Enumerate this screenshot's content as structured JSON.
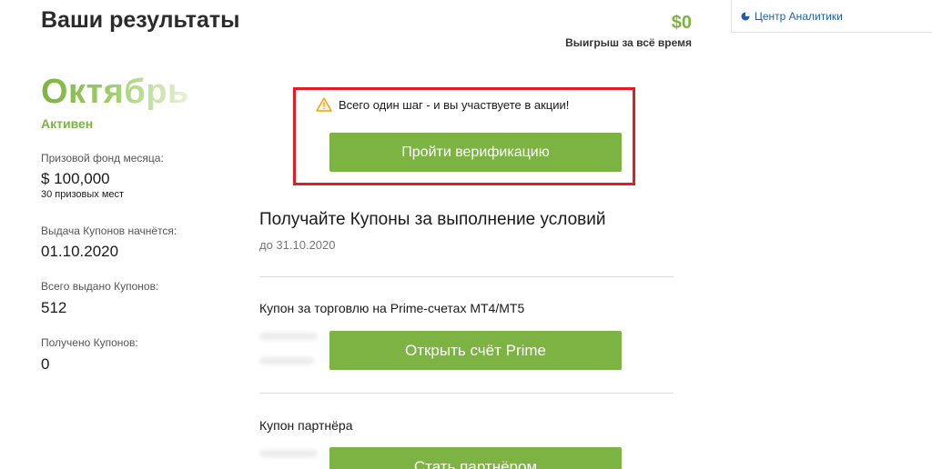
{
  "header": {
    "title": "Ваши результаты",
    "winnings_amount": "$0",
    "winnings_label": "Выигрыш за всё время"
  },
  "sidebar_card": {
    "link_label": "Центр Аналитики",
    "icon": "pie-chart-icon"
  },
  "month": {
    "name": "Октябрь",
    "status": "Активен",
    "prize_fund_label": "Призовой фонд месяца:",
    "prize_fund_value": "$ 100,000",
    "prize_places": "30 призовых мест",
    "issue_start_label": "Выдача Купонов начнётся:",
    "issue_start_value": "01.10.2020",
    "total_issued_label": "Всего выдано Купонов:",
    "total_issued_value": "512",
    "received_label": "Получено Купонов:",
    "received_value": "0"
  },
  "verification": {
    "message": "Всего один шаг - и вы участвуете в акции!",
    "button_label": "Пройти верификацию",
    "icon": "warning-icon"
  },
  "coupons_section": {
    "title": "Получайте Купоны за выполнение условий",
    "deadline": "до 31.10.2020",
    "items": [
      {
        "title": "Купон за торговлю на Prime-счетах MT4/MT5",
        "button_label": "Открыть счёт Prime"
      },
      {
        "title": "Купон партнёра",
        "button_label": "Стать партнёром"
      }
    ]
  },
  "colors": {
    "accent_green": "#7cb342",
    "highlight_red": "#e31b23",
    "link_blue": "#1f5fa8"
  }
}
